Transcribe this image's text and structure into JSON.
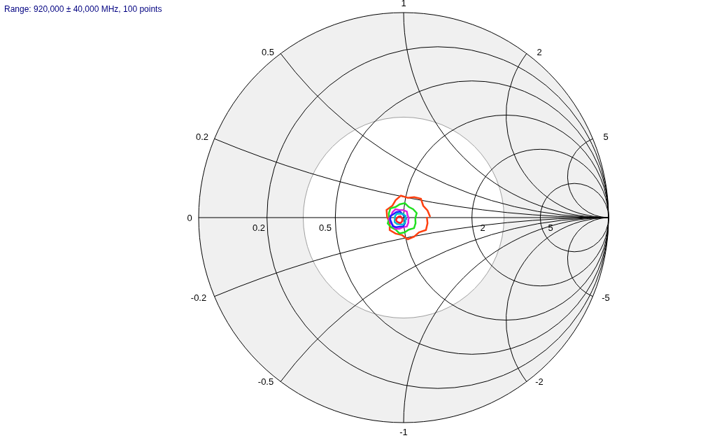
{
  "range_text": "Range: 920,000 ± 40,000 MHz, 100 points",
  "resistance_labels": [
    "0",
    "0.2",
    "0.5",
    "2",
    "5"
  ],
  "reactance_labels": [
    "1",
    "0.5",
    "2",
    "0.2",
    "5",
    "-0.2",
    "-5",
    "-0.5",
    "-2",
    "-1"
  ]
}
